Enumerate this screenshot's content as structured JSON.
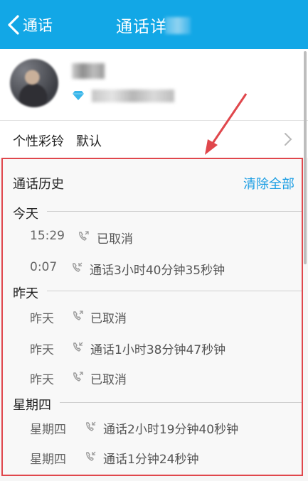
{
  "header": {
    "back_label": "通话",
    "title": "通话详"
  },
  "settings": {
    "ringtone_label": "个性彩铃",
    "ringtone_value": "默认"
  },
  "history": {
    "title": "通话历史",
    "clear_label": "清除全部",
    "groups": [
      {
        "label": "今天",
        "records": [
          {
            "time": "15:29",
            "desc": "已取消"
          },
          {
            "time": "0:07",
            "desc": "通话3小时40分钟35秒钟"
          }
        ]
      },
      {
        "label": "昨天",
        "records": [
          {
            "time": "昨天",
            "desc": "已取消"
          },
          {
            "time": "昨天",
            "desc": "通话1小时38分钟47秒钟"
          },
          {
            "time": "昨天",
            "desc": "已取消"
          }
        ]
      },
      {
        "label": "星期四",
        "records": [
          {
            "time": "星期四",
            "desc": "通话2小时19分钟40秒钟"
          },
          {
            "time": "星期四",
            "desc": "通话1分钟24秒钟"
          }
        ]
      }
    ]
  },
  "icons": {
    "back": "chevron-left-icon",
    "diamond": "diamond-icon",
    "arrow": "chevron-right-icon",
    "call": "call-phone-icon"
  },
  "colors": {
    "header": "#12a7e6",
    "accent": "#1a9de3",
    "highlight_border": "#e0474c"
  }
}
